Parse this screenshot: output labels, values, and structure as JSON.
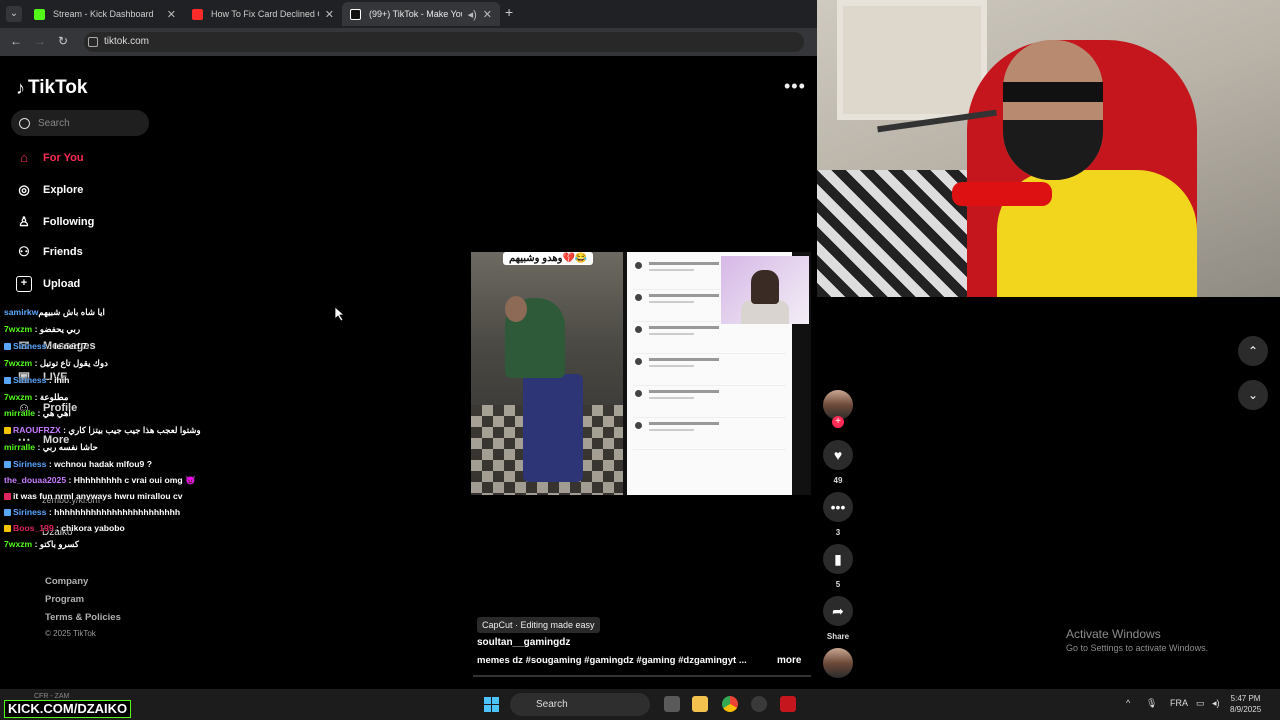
{
  "browser": {
    "tabs": [
      {
        "title": "Stream - Kick Dashboard",
        "favicon_color": "#53fc18"
      },
      {
        "title": "How To Fix Card Declined On E",
        "favicon_color": "#ff2b2b"
      },
      {
        "title": "(99+) TikTok - Make Your Da",
        "favicon_color": "#ffffff"
      }
    ],
    "url": "tiktok.com"
  },
  "tiktok": {
    "logo": "TikTok",
    "search_placeholder": "Search",
    "menu": [
      {
        "label": "For You",
        "icon": "home-icon"
      },
      {
        "label": "Explore",
        "icon": "compass-icon"
      },
      {
        "label": "Following",
        "icon": "following-icon"
      },
      {
        "label": "Friends",
        "icon": "friends-icon"
      },
      {
        "label": "Upload",
        "icon": "upload-icon"
      },
      {
        "label": "Messages",
        "icon": "messages-icon"
      },
      {
        "label": "LIVE",
        "icon": "live-icon"
      },
      {
        "label": "Profile",
        "icon": "profile-icon"
      },
      {
        "label": "More",
        "icon": "more-icon"
      }
    ],
    "footer": [
      "Company",
      "Program",
      "Terms & Policies"
    ],
    "copyright": "© 2025 TikTok",
    "video": {
      "overlay_caption": "وهدو وشبيهم💔😂",
      "capcut_label": "CapCut · Editing made easy",
      "author": "soultan__gamingdz",
      "hashtags": "memes dz  #sougaming  #gamingdz  #gaming  #dzgamingyt  ...",
      "more_label": "more"
    },
    "actions": {
      "likes": "49",
      "comments": "3",
      "saves": "5",
      "share_label": "Share"
    }
  },
  "chat": [
    {
      "user": "samirkw",
      "msg": "ايا شاه باش شبيهم",
      "color": "#5aa7ff"
    },
    {
      "user": "7wxzm",
      "msg": "ربي يحفضو",
      "color": "#53fc18"
    },
    {
      "user": "Siriness",
      "msg": "le nerf 7",
      "color": "#5aa7ff"
    },
    {
      "user": "7wxzm",
      "msg": "دوك يقول تاع توتيل",
      "color": "#53fc18"
    },
    {
      "user": "Siriness",
      "msg": "ihih",
      "color": "#5aa7ff"
    },
    {
      "user": "7wxzm",
      "msg": "مطلوعة",
      "color": "#53fc18"
    },
    {
      "user": "mirralle",
      "msg": "اهي هي",
      "color": "#53fc18"
    },
    {
      "user": "RAOUFRZX",
      "msg": "وشتوا لعجب هذا جيب جيب بيتزا كاري",
      "color": "#c77dff"
    },
    {
      "user": "mirralle",
      "msg": "حاشا نفسه ربي",
      "color": "#53fc18"
    },
    {
      "user": "Siriness",
      "msg": "wchnou hadak mlfou9 ?",
      "color": "#5aa7ff"
    },
    {
      "user": "the_douaa2025",
      "msg": "Hhhhhhhhh c vrai oui omg 😈",
      "color": "#c77dff"
    },
    {
      "user": "",
      "msg": "it was fun nrml anyways hwru mirallou cv",
      "color": "#ffffff"
    },
    {
      "user": "Siriness",
      "msg": "hhhhhhhhhhhhhhhhhhhhhhhh",
      "color": "#5aa7ff"
    },
    {
      "user": "Boos_199",
      "msg": "chikora yabobo",
      "color": "#e0245e"
    },
    {
      "user": "7wxzm",
      "msg": "كسرو باكتو",
      "color": "#53fc18"
    }
  ],
  "background_text": {
    "user_handle": "zembo.y/kl.om",
    "username": "Dzaiko"
  },
  "system": {
    "activate_title": "Activate Windows",
    "activate_sub": "Go to Settings to activate Windows.",
    "taskbar_search": "Search",
    "language": "FRA",
    "time": "5:47 PM",
    "date": "8/9/2025",
    "kick_url": "KICK.COM/DZAIKO",
    "cfr_label": "CFR - ZAM"
  }
}
